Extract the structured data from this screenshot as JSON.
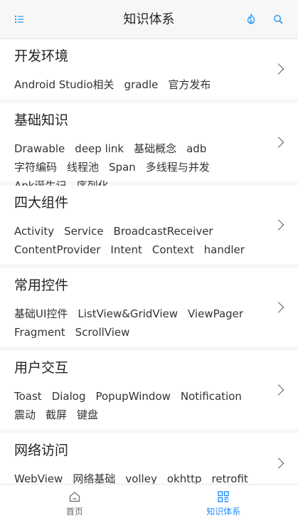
{
  "header": {
    "title": "知识体系",
    "menu_icon": "list-icon",
    "action_icons": [
      "flame-icon",
      "search-icon"
    ]
  },
  "colors": {
    "accent": "#2196f3",
    "tab_active": "#1e90ff"
  },
  "categories": [
    {
      "title": "开发环境",
      "tags": [
        "Android Studio相关",
        "gradle",
        "官方发布"
      ]
    },
    {
      "title": "基础知识",
      "tags": [
        "Drawable",
        "deep link",
        "基础概念",
        "adb",
        "字符编码",
        "线程池",
        "Span",
        "多线程与并发",
        "Apk诞生记",
        "序列化"
      ]
    },
    {
      "title": "四大组件",
      "tags": [
        "Activity",
        "Service",
        "BroadcastReceiver",
        "ContentProvider",
        "Intent",
        "Context",
        "handler"
      ]
    },
    {
      "title": "常用控件",
      "tags": [
        "基础UI控件",
        "ListView&GridView",
        "ViewPager",
        "Fragment",
        "ScrollView"
      ]
    },
    {
      "title": "用户交互",
      "tags": [
        "Toast",
        "Dialog",
        "PopupWindow",
        "Notification",
        "震动",
        "截屏",
        "键盘"
      ]
    },
    {
      "title": "网络访问",
      "tags": [
        "WebView",
        "网络基础",
        "volley",
        "okhttp",
        "retrofit"
      ]
    }
  ],
  "tabbar": {
    "tabs": [
      {
        "label": "首页",
        "icon": "home-icon",
        "active": false
      },
      {
        "label": "知识体系",
        "icon": "grid-icon",
        "active": true
      }
    ]
  }
}
